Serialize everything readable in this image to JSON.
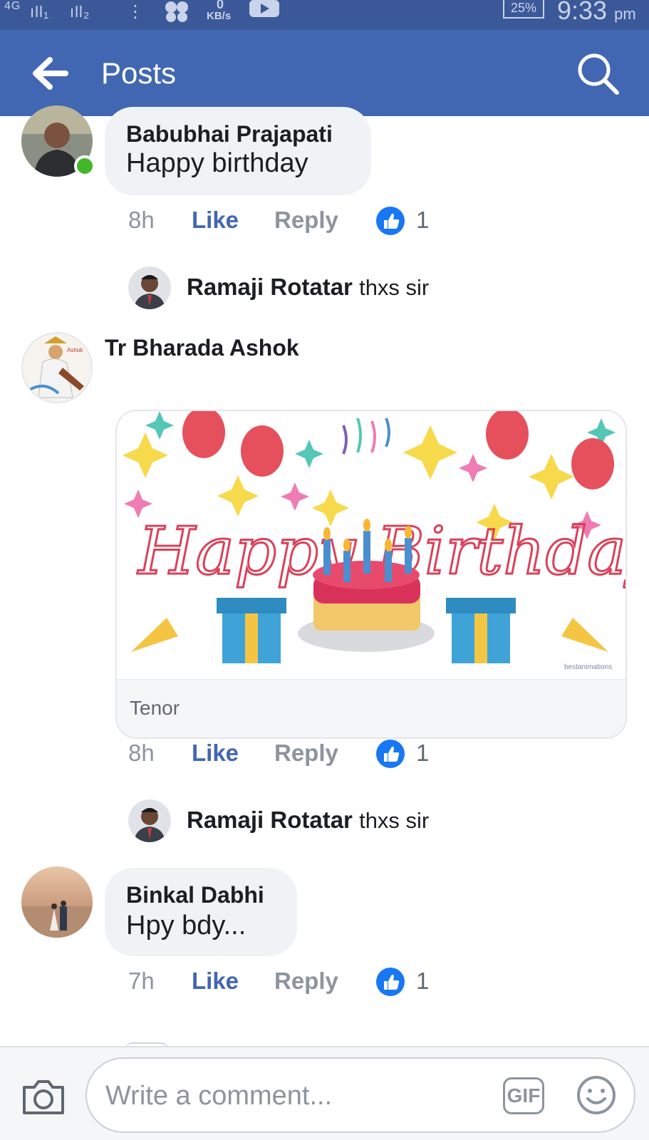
{
  "status_bar": {
    "network": "4G",
    "sim1": "ıll₁",
    "sim2": "ıll₂",
    "speed_value": "0",
    "speed_unit": "KB/s",
    "battery": "25%",
    "time": "9:33",
    "ampm": "pm"
  },
  "header": {
    "title": "Posts",
    "back_icon": "back-arrow-icon",
    "search_icon": "search-icon"
  },
  "comments": [
    {
      "author": "Babubhai Prajapati",
      "text": "Happy birthday",
      "time": "8h",
      "like_label": "Like",
      "reply_label": "Reply",
      "like_count": "1",
      "online": true,
      "reply": {
        "author": "Ramaji Rotatar",
        "text": "thxs sir"
      }
    },
    {
      "author": "Tr Bharada Ashok",
      "avatar_text": "Ashok",
      "gif": {
        "greeting": "Happy Birthday",
        "watermark": "bestanimations",
        "source": "Tenor"
      },
      "time": "8h",
      "like_label": "Like",
      "reply_label": "Reply",
      "like_count": "1",
      "reply": {
        "author": "Ramaji Rotatar",
        "text": "thxs sir"
      }
    },
    {
      "author": "Binkal Dabhi",
      "text": "Hpy bdy...",
      "time": "7h",
      "like_label": "Like",
      "reply_label": "Reply",
      "like_count": "1"
    }
  ],
  "composer": {
    "placeholder": "Write a comment...",
    "gif_label": "GIF",
    "camera_icon": "camera-icon",
    "emoji_icon": "emoji-icon"
  },
  "colors": {
    "header": "#4267b2",
    "status_bar": "#3b5998",
    "like_blue": "#4267b2",
    "online_green": "#42b72a"
  }
}
